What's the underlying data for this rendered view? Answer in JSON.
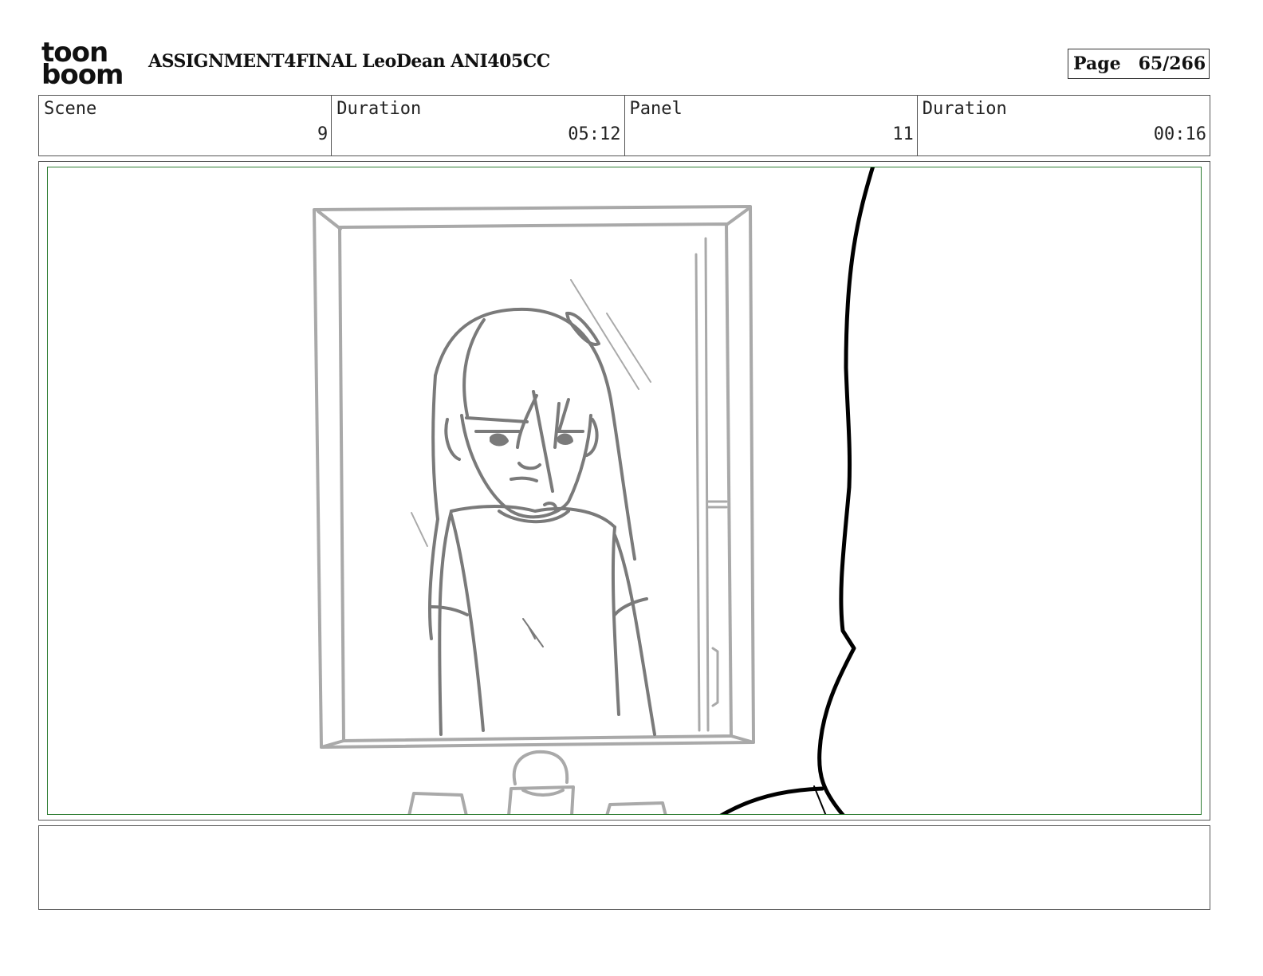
{
  "header": {
    "logo_line1": "toon",
    "logo_line2": "boom",
    "title": "ASSIGNMENT4FINAL LeoDean ANI405CC",
    "page_label": "Page",
    "page_value": "65/266"
  },
  "info": {
    "scene_label": "Scene",
    "scene_value": "9",
    "scene_duration_label": "Duration",
    "scene_duration_value": "05:12",
    "panel_label": "Panel",
    "panel_value": "11",
    "panel_duration_label": "Duration",
    "panel_duration_value": "00:16"
  },
  "panel": {
    "sketch_color": "#a9a9a9",
    "figure_color": "#7a7a7a",
    "foreground_color": "#000000",
    "safe_frame_color": "#2e7d32"
  },
  "notes": {
    "text": ""
  }
}
